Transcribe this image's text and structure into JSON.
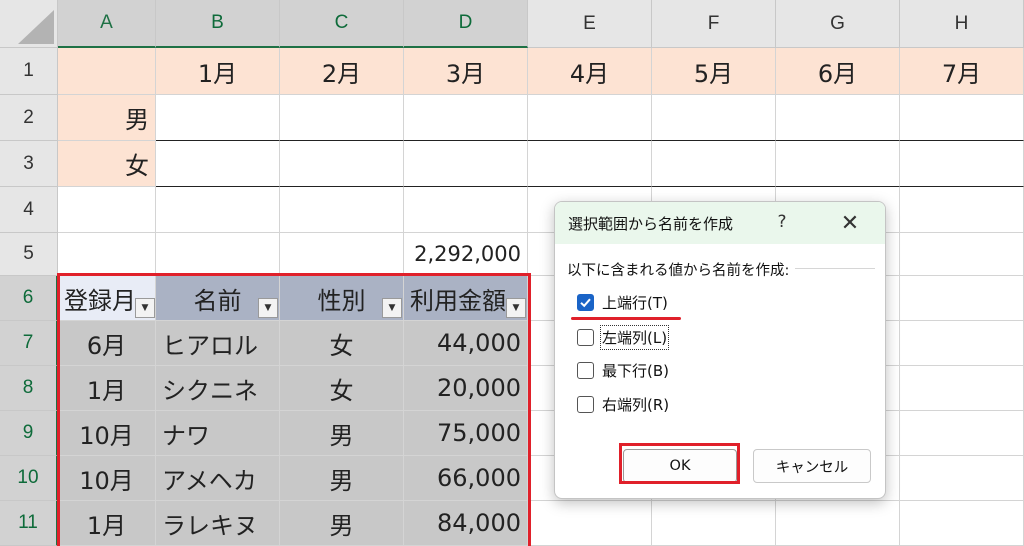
{
  "columns": [
    "A",
    "B",
    "C",
    "D",
    "E",
    "F",
    "G",
    "H"
  ],
  "rows": [
    "1",
    "2",
    "3",
    "4",
    "5",
    "6",
    "7",
    "8",
    "9",
    "10",
    "11"
  ],
  "cells": {
    "month_headers": [
      "1月",
      "2月",
      "3月",
      "4月",
      "5月",
      "6月",
      "7月"
    ],
    "row_labels": [
      "男",
      "女"
    ],
    "total": "2,292,000",
    "table_headers": [
      "登録月",
      "名前",
      "性別",
      "利用金額"
    ],
    "table_rows": [
      [
        "6月",
        "ヒアロル",
        "女",
        "44,000"
      ],
      [
        "1月",
        "シクニネ",
        "女",
        "20,000"
      ],
      [
        "10月",
        "ナワ",
        "男",
        "75,000"
      ],
      [
        "10月",
        "アメヘカ",
        "男",
        "66,000"
      ],
      [
        "1月",
        "ラレキヌ",
        "男",
        "84,000"
      ]
    ]
  },
  "dialog": {
    "title": "選択範囲から名前を作成",
    "help": "?",
    "close": "✕",
    "prompt": "以下に含まれる値から名前を作成:",
    "options": [
      {
        "label": "上端行(T)",
        "checked": true
      },
      {
        "label": "左端列(L)",
        "checked": false
      },
      {
        "label": "最下行(B)",
        "checked": false
      },
      {
        "label": "右端列(R)",
        "checked": false
      }
    ],
    "ok_label": "OK",
    "cancel_label": "キャンセル"
  },
  "colors": {
    "header_fill": "#fde3d3",
    "table_header_fill": "#aab2c4",
    "table_body_fill": "#c8c8c8",
    "highlight": "#e0202a",
    "checkbox": "#1a64c7"
  }
}
